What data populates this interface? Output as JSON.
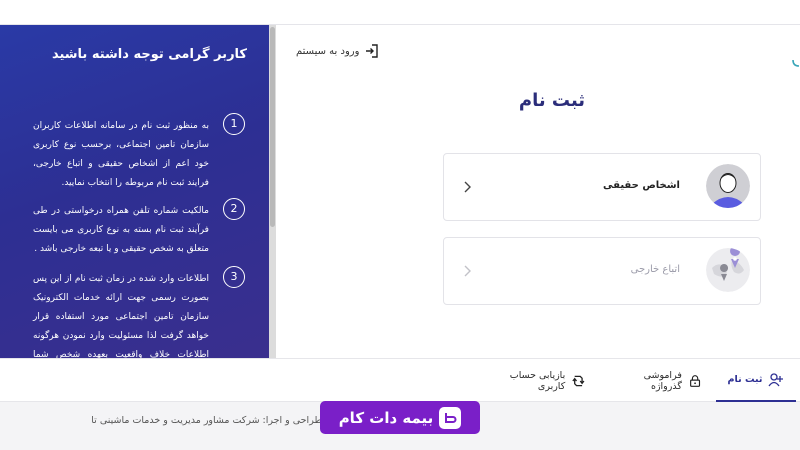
{
  "info_panel": {
    "title": "کاربر گرامی توجه داشته باشید",
    "items": [
      {
        "num": "1",
        "text": "به منظور ثبت نام در سامانه اطلاعات کاربران سازمان تامین اجتماعی، برحسب نوع کاربری خود اعم از اشخاص حقیقی و اتباع خارجی، فرایند ثبت نام مربوطه را انتخاب نمایید."
      },
      {
        "num": "2",
        "text": "مالکیت شماره تلفن همراه درخواستی در طی فرآیند ثبت نام بسته به نوع کاربری می بایست متعلق به شخص حقیقی و یا تبعه خارجی باشد ."
      },
      {
        "num": "3",
        "text": "اطلاعات وارد شده در زمان ثبت نام از این پس بصورت رسمی جهت ارائه خدمات الکترونیک سازمان تامین اجتماعی مورد استفاده قرار خواهد گرفت لذا مسئولیت وارد نمودن هرگونه اطلاعات خلاف واقعیت بعهده شخص شما خواهد بود."
      }
    ]
  },
  "login_link": {
    "label": "ورود به سیستم",
    "icon": "login-icon"
  },
  "page_title": "ثبت نام",
  "cards": [
    {
      "label": "اشخاص حقیقی",
      "icon": "person-avatar-icon"
    },
    {
      "label": "اتباع خارجی",
      "icon": "globe-map-icon"
    }
  ],
  "tabs": [
    {
      "label": "ثبت نام",
      "icon": "add-user-icon",
      "active": true
    },
    {
      "label": "فراموشی گذرواژه",
      "icon": "lock-icon",
      "active": false
    },
    {
      "label": "بازیابی حساب کاربری",
      "icon": "refresh-icon",
      "active": false
    }
  ],
  "footer": {
    "text": "طراحی و اجرا: شرکت مشاور مدیریت و خدمات ماشینی تا"
  },
  "watermark": {
    "text": "بیمه دات کام"
  },
  "colors": {
    "panel": "#2d2f93",
    "accent": "#2d2f93",
    "badge": "#7a1fc8"
  }
}
